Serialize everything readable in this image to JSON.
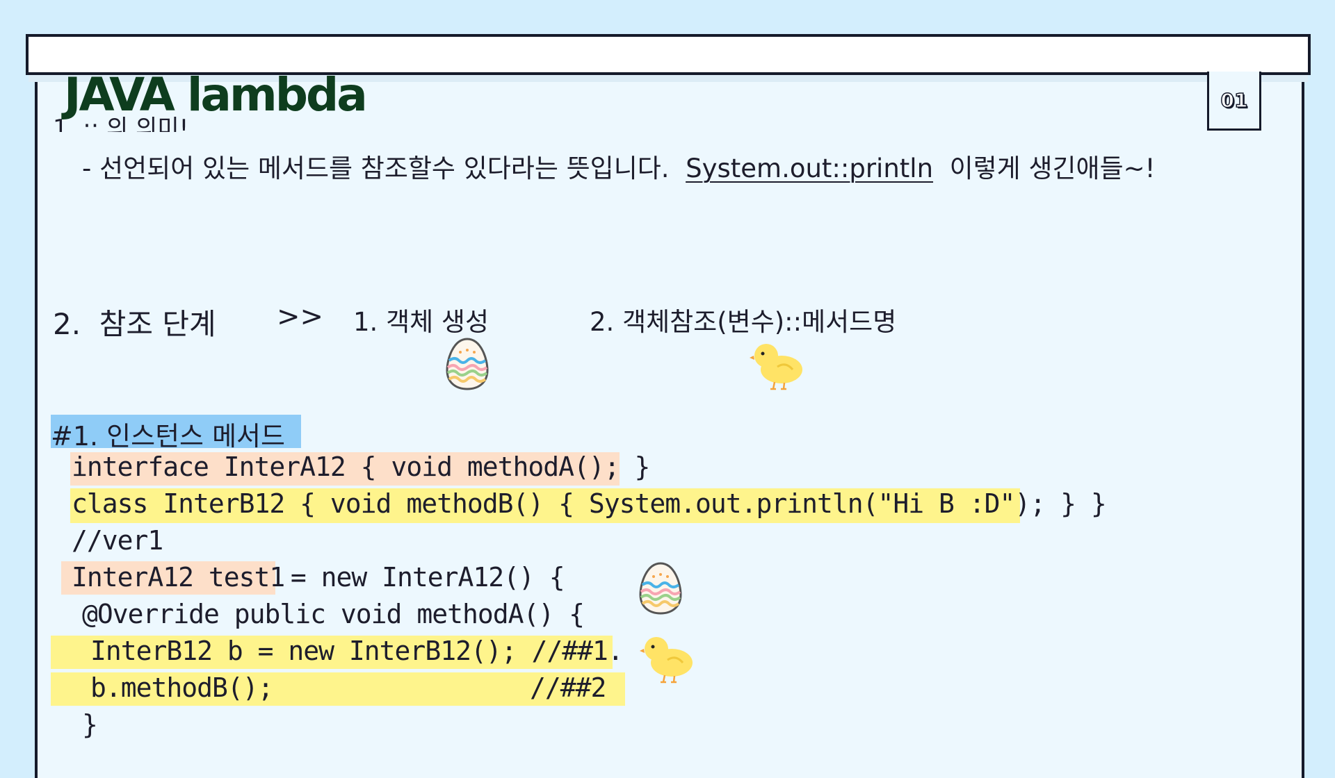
{
  "header": {
    "title": "JAVA lambda",
    "page_badge": "01"
  },
  "section1": {
    "heading_partial": "1. :: 의 의미!",
    "definition": "- 선언되어 있는 메서드를 참조할수 있다라는 뜻입니다.",
    "example": "System.out::println",
    "suffix": "이렇게 생긴애들~!"
  },
  "section2": {
    "label": "2.  참조 단계",
    "arrow": ">>",
    "step1": "1. 객체 생성",
    "step2": "2. 객체참조(변수)::메서드명"
  },
  "code_block": {
    "heading": "#1. 인스턴스 메서드",
    "lines": [
      "interface InterA12 { void methodA(); }",
      "class InterB12 { void methodB() { System.out.println(\"Hi B :D\"); } }",
      "//ver1",
      "InterA12 test1",
      " = new InterA12() {",
      "@Override public void methodA() {",
      "InterB12 b = new InterB12(); //##1.",
      "b.methodB();",
      "//##2",
      "}"
    ]
  },
  "icons": {
    "egg": "easter-egg-icon",
    "chick": "chick-icon"
  },
  "colors": {
    "background": "#d3eefd",
    "page": "#edf8fe",
    "title": "#0e3d1e",
    "highlight_blue": "#8fccf7",
    "highlight_peach": "#fddfc9",
    "highlight_yellow": "#fef48c"
  }
}
